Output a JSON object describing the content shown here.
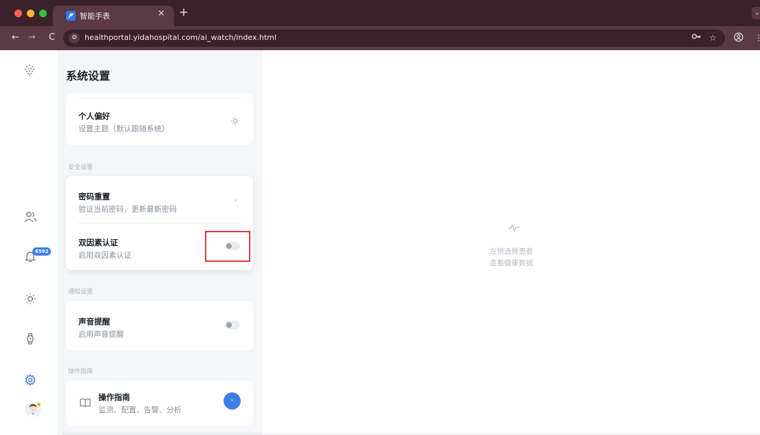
{
  "browser": {
    "tab_title": "智能手表",
    "tab_close": "×",
    "new_tab": "+",
    "url": "healthportal.yidahospital.com/ai_watch/index.html",
    "nav_back": "←",
    "nav_forward": "→",
    "nav_reload": "C",
    "icons": [
      "back-arrow-icon",
      "forward-arrow-icon",
      "reload-icon",
      "site-info-icon",
      "password-key-icon",
      "bookmark-star-icon",
      "profile-icon",
      "more-menu-icon"
    ]
  },
  "rail": {
    "items": [
      {
        "icon": "logo-dots-icon",
        "active": false
      },
      {
        "icon": "patients-icon",
        "active": false
      },
      {
        "icon": "alarm-bell-icon",
        "active": false,
        "badge": "6592"
      },
      {
        "icon": "theme-sun-icon",
        "active": false
      },
      {
        "icon": "watch-icon",
        "active": false
      },
      {
        "icon": "settings-gear-icon",
        "active": true
      }
    ],
    "accent_color": "#3d7fe8"
  },
  "settings": {
    "title": "系统设置",
    "personal": {
      "title": "个人偏好",
      "desc": "设置主题（默认跟随系统）",
      "icon": "sun-icon"
    },
    "security_label": "安全设置",
    "password_reset": {
      "title": "密码重置",
      "desc": "验证当前密码，更新最新密码",
      "chevron": "›"
    },
    "two_factor": {
      "title": "双因素认证",
      "desc": "启用双因素认证",
      "enabled": false
    },
    "notify_label": "通知设置",
    "sound": {
      "title": "声音提醒",
      "desc": "启用声音提醒",
      "enabled": false
    },
    "guide_label": "操作指南",
    "guide": {
      "title": "操作指南",
      "desc": "监测、配置、告警、分析",
      "icon": "book-icon",
      "button": "›"
    }
  },
  "main": {
    "empty_icon": "pulse-icon",
    "empty_line1": "左侧选择患者",
    "empty_line2": "查看健康数据"
  },
  "colors": {
    "highlight": "#e0383e",
    "chrome_dark": "#3b2129",
    "chrome_mid": "#5a3a44"
  }
}
